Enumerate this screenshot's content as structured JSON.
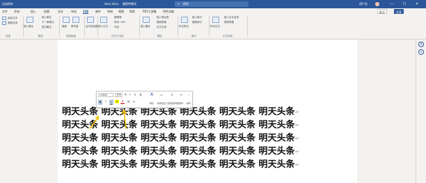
{
  "titlebar": {
    "autosave": "自动保存",
    "doc_name": "docx.docx",
    "mode": "兼容性模式",
    "search_placeholder": "搜索",
    "user": "用户名",
    "min": "—",
    "max": "☐",
    "close": "✕"
  },
  "tabs": [
    "文件",
    "开始",
    "插入",
    "绘图",
    "设计",
    "布局",
    "引用",
    "邮件",
    "审阅",
    "视图",
    "帮助",
    "PDF工具集",
    "特色功能"
  ],
  "active_tab": "引用",
  "comment_button": "批注",
  "share_button": "共享",
  "ribbon": {
    "toc_items": [
      "添加文字",
      "更新目录"
    ],
    "toc_group": "目录",
    "footnote_big": "插入脚注",
    "footnote_items": [
      "插入尾注",
      "下一条脚注",
      "显示备注"
    ],
    "footnote_group": "脚注",
    "research_items": [
      "搜索",
      "研究者"
    ],
    "research_group": "信息检索",
    "ext_label": "运行检查器",
    "cite_big": "插入引文",
    "cite_items": [
      "管理源",
      "样式: APA",
      "书目"
    ],
    "cite_group": "引文与书目",
    "caption_big": "插入题注",
    "caption_items": [
      "插入表目录",
      "更新表格",
      "交叉引用"
    ],
    "caption_group": "题注",
    "index_big": "标记条目",
    "index_items": [
      "插入索引",
      "更新索引"
    ],
    "index_group": "索引",
    "toa_big": "标记引文",
    "toa_items": [
      "插入引文目录",
      "更新表格"
    ],
    "toa_group": "引文目录"
  },
  "mini_toolbar": {
    "font": "Calibri",
    "size": "五号",
    "grow": "A",
    "shrink": "A",
    "bold": "B",
    "italic": "I",
    "underline": "U",
    "highlight": "A",
    "font_color": "A",
    "styles_label": "样式",
    "new_comment_label": "新建批注",
    "line_spacing_label": "行和段落间距",
    "center_label": "居中",
    "indent_label": "编号"
  },
  "tooltip": "加粗 (Ctrl+B)",
  "doc_word": "明天头条",
  "doc_lines": [
    [
      "明天头条",
      "明天头条",
      "明天头条",
      "明天头条",
      "明天头条",
      "明天头条"
    ],
    [
      "明天头条",
      "明天头条",
      "明天头条",
      "明天头条",
      "明天头条",
      "明天头条"
    ],
    [
      "明天头条",
      "明天头条",
      "明天头条",
      "明天头条",
      "明天头条",
      "明天头条"
    ],
    [
      "明天头条",
      "明天头条",
      "明天头条",
      "明天头条",
      "明天头条",
      "明天头条"
    ],
    [
      "明天头条",
      "明天头条",
      "明天头条",
      "明天头条",
      "明天头条",
      "明天头条"
    ]
  ],
  "return_mark": "↵",
  "side_icons": [
    "A",
    "✎"
  ],
  "colors": {
    "title_bar": "#2b579a",
    "arrow": "#f5c400"
  }
}
